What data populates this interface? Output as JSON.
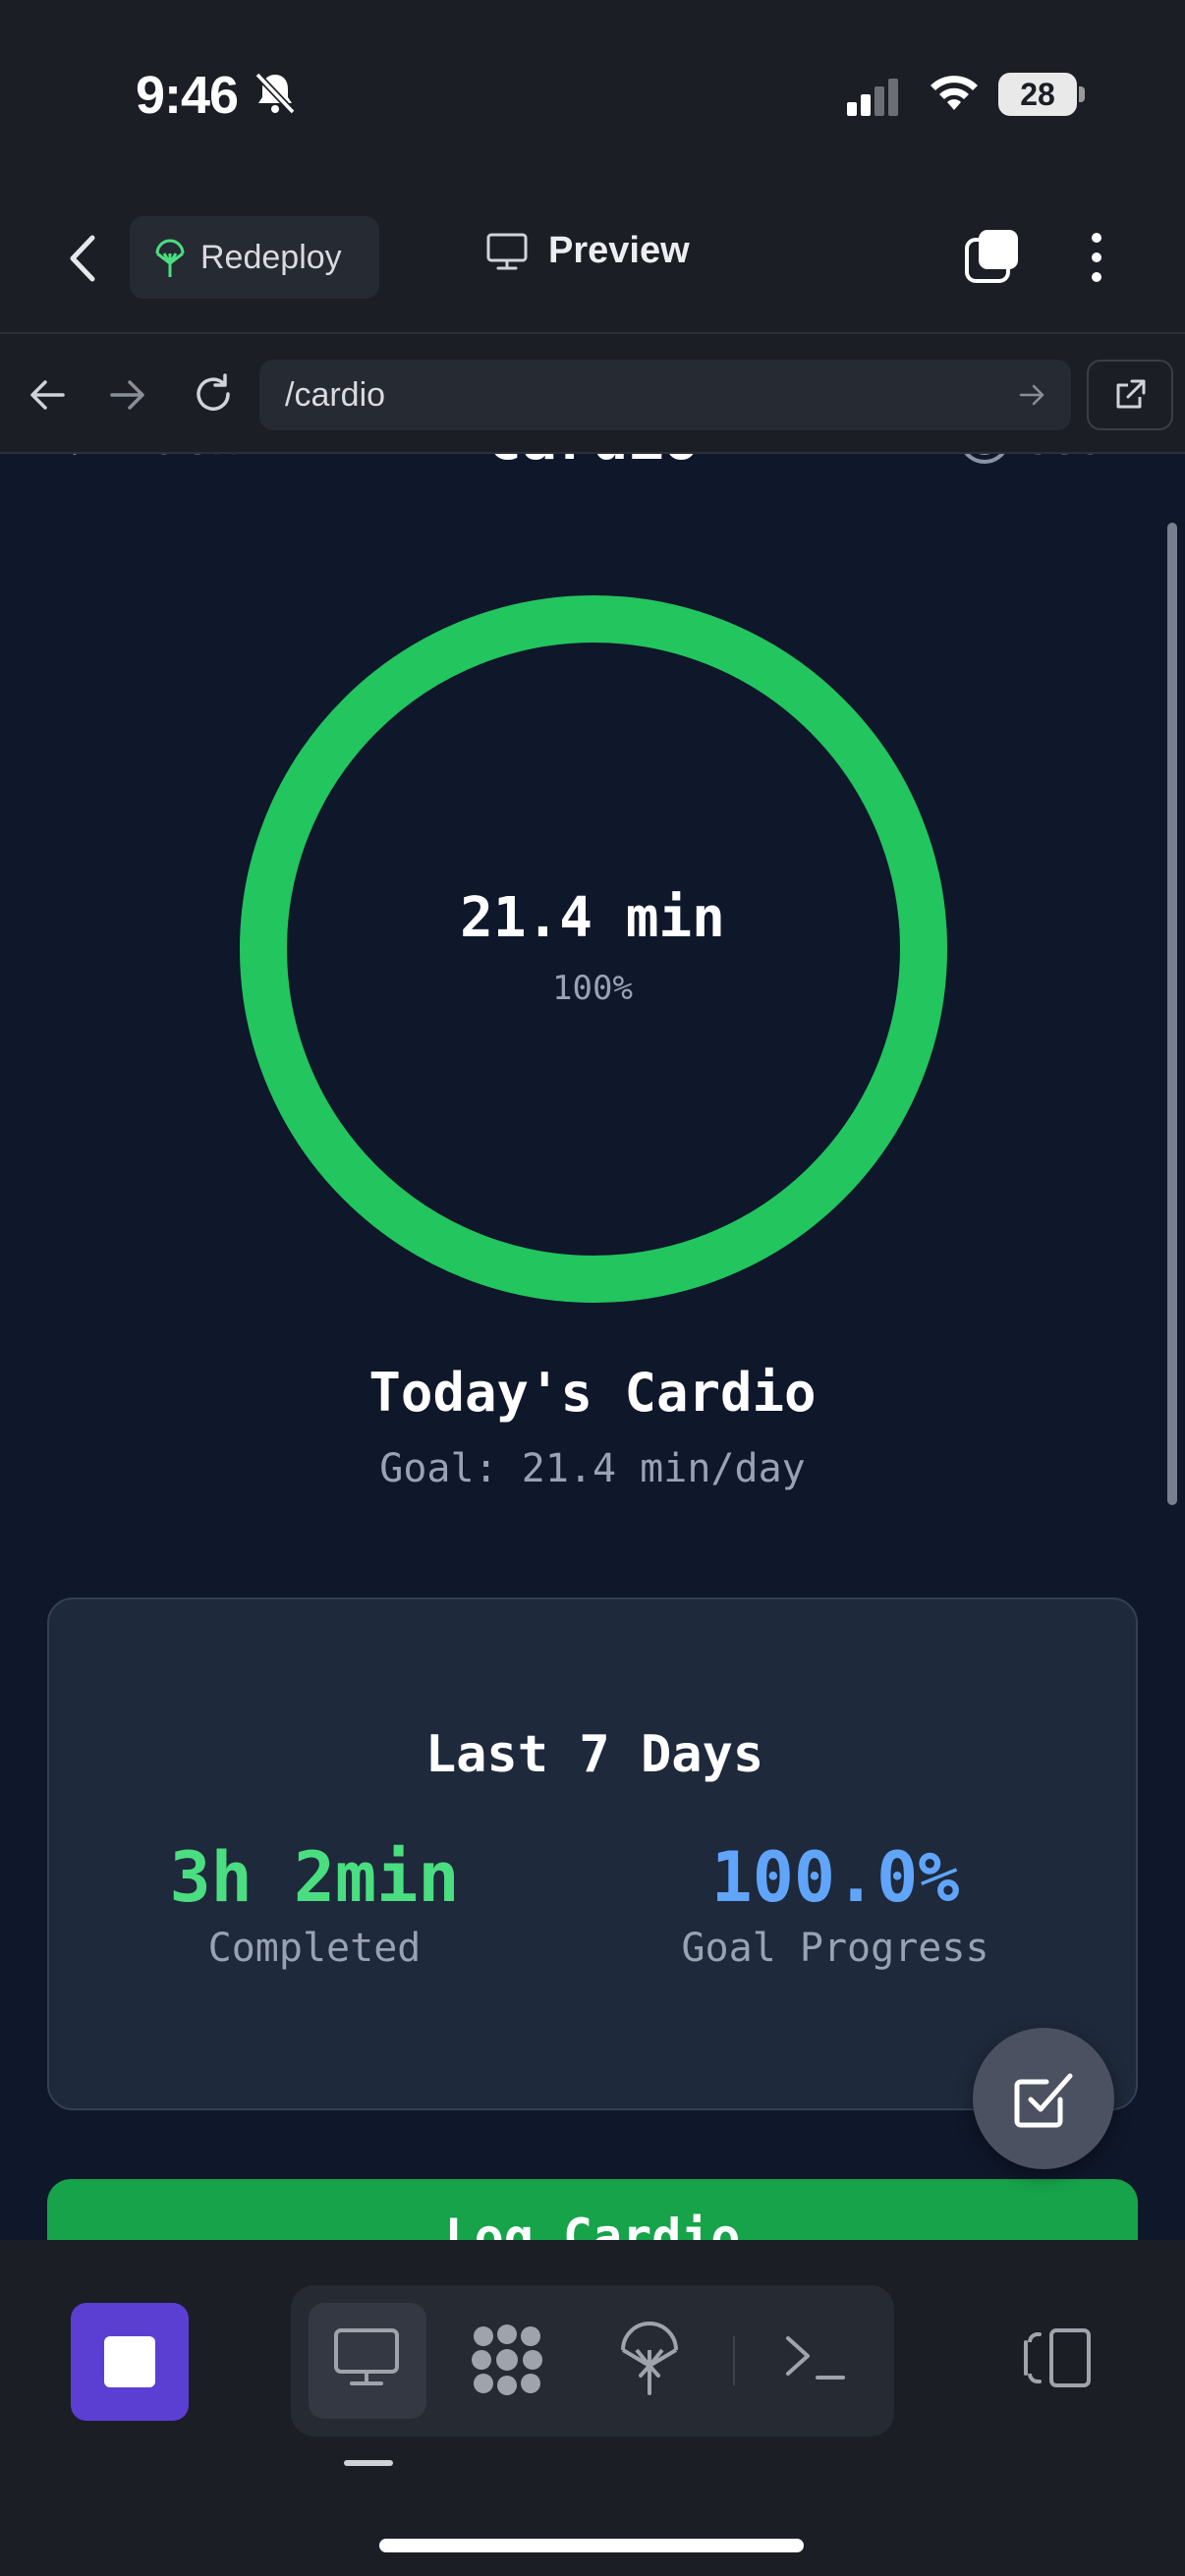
{
  "status_bar": {
    "time": "9:46",
    "battery": "28"
  },
  "header": {
    "redeploy_label": "Redeploy",
    "preview_label": "Preview"
  },
  "url_bar": {
    "url": "/cardio"
  },
  "page": {
    "back_label": "Back",
    "title": "Cardio",
    "goal_label": "Goal",
    "ring": {
      "value": "21.4 min",
      "percent_label": "100%",
      "progress": 1.0,
      "color": "#22c55e"
    },
    "today_title": "Today's Cardio",
    "today_goal": "Goal: 21.4 min/day",
    "summary": {
      "title": "Last 7 Days",
      "completed_value": "3h 2min",
      "completed_label": "Completed",
      "progress_value": "100.0%",
      "progress_label": "Goal Progress"
    },
    "log_button_label": "Log Cardio"
  },
  "colors": {
    "accent_green": "#22c55e",
    "accent_blue": "#60a5fa",
    "stop_purple": "#5b3fd3"
  }
}
